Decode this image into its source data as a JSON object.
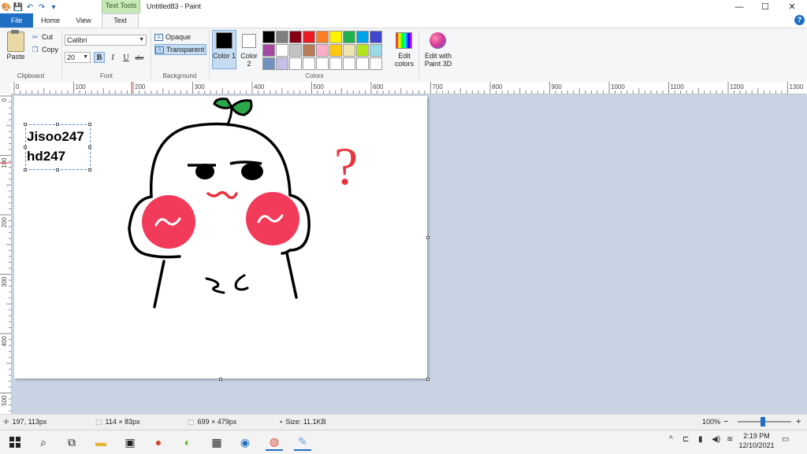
{
  "window": {
    "title": "Untitled83 - Paint",
    "context_tab_group": "Text Tools",
    "controls": {
      "minimize": "—",
      "maximize": "☐",
      "close": "✕"
    }
  },
  "quick_access": {
    "icons": [
      "paint-app-icon",
      "save-icon",
      "undo-icon",
      "redo-icon",
      "customize-icon"
    ]
  },
  "tabs": [
    {
      "label": "File",
      "active": false
    },
    {
      "label": "Home",
      "active": false
    },
    {
      "label": "View",
      "active": false
    },
    {
      "label": "Text",
      "active": true
    }
  ],
  "ribbon": {
    "clipboard": {
      "group_label": "Clipboard",
      "paste": "Paste",
      "cut": "Cut",
      "copy": "Copy"
    },
    "font": {
      "group_label": "Font",
      "family": "Calibri",
      "size": "20",
      "bold": "B",
      "italic": "I",
      "underline": "U",
      "strikethrough": "abc"
    },
    "background": {
      "group_label": "Background",
      "opaque": "Opaque",
      "transparent": "Transparent",
      "selected": "Transparent"
    },
    "colors": {
      "group_label": "Colors",
      "color1_label": "Color 1",
      "color2_label": "Color 2",
      "color1": "#000000",
      "color2": "#ffffff",
      "palette": [
        "#000000",
        "#7f7f7f",
        "#880015",
        "#ed1c24",
        "#ff7f27",
        "#fff200",
        "#22b14c",
        "#00a2e8",
        "#3f48cc",
        "#a349a4",
        "#ffffff",
        "#c3c3c3",
        "#b97a57",
        "#ffaec9",
        "#ffc90e",
        "#efe4b0",
        "#b5e61d",
        "#99d9ea",
        "#7092be",
        "#c8bfe7",
        "#ffffff",
        "#ffffff",
        "#ffffff",
        "#ffffff",
        "#ffffff",
        "#ffffff",
        "#ffffff",
        "#ffffff",
        "#ffffff",
        "#ffffff"
      ],
      "edit_colors": "Edit colors",
      "edit_paint3d": "Edit with Paint 3D"
    }
  },
  "ruler": {
    "horizontal": [
      "0",
      "100",
      "200",
      "300",
      "400",
      "500",
      "600",
      "700",
      "800",
      "900",
      "1000",
      "1100",
      "1200",
      "1300"
    ],
    "vertical": [
      "0",
      "100",
      "200",
      "300",
      "400",
      "500"
    ]
  },
  "canvas": {
    "text_box_content": "Jisoo247\nhd247",
    "drawing": {
      "question_mark": "?",
      "accent_red": "#e8343f",
      "cheek_pink": "#f23b5a",
      "leaf_green": "#2aa84a"
    }
  },
  "status": {
    "cursor_pos": "197, 113px",
    "selection_size": "114 × 83px",
    "canvas_size": "699 × 479px",
    "file_size": "Size: 11.1KB",
    "zoom": "100%",
    "zoom_out": "−",
    "zoom_in": "+"
  },
  "taskbar": {
    "apps": [
      "windows-start-icon",
      "search-icon",
      "task-view-icon",
      "file-explorer-icon",
      "store-icon",
      "powerpoint-icon",
      "game-icon",
      "calculator-icon",
      "snipping-icon",
      "chrome-icon",
      "paint-icon"
    ],
    "time": "2:19 PM",
    "date": "12/10/2021"
  }
}
